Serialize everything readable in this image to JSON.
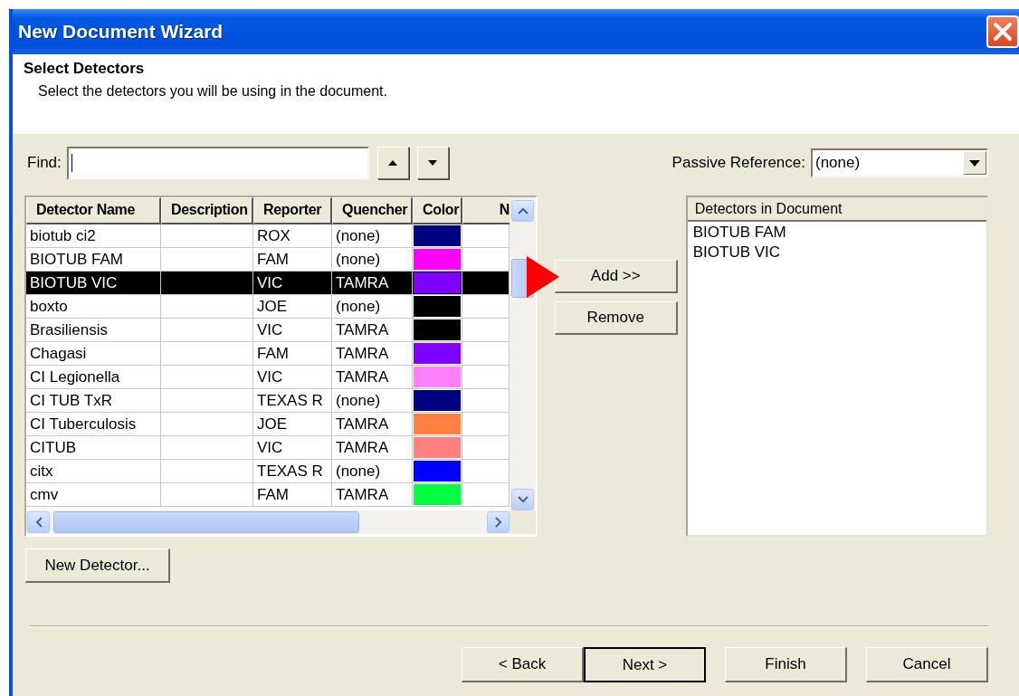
{
  "window": {
    "title": "New Document Wizard"
  },
  "header": {
    "title": "Select Detectors",
    "subtitle": "Select the detectors you will be using in the document."
  },
  "find": {
    "label": "Find:"
  },
  "passive_reference": {
    "label": "Passive Reference:",
    "value": "(none)"
  },
  "table": {
    "columns": [
      "Detector Name",
      "Description",
      "Reporter",
      "Quencher",
      "Color",
      "N"
    ],
    "rows": [
      {
        "detector_name": "biotub ci2",
        "reporter": "ROX",
        "quencher": "(none)",
        "color": "#000080",
        "selected": false
      },
      {
        "detector_name": "BIOTUB FAM",
        "reporter": "FAM",
        "quencher": "(none)",
        "color": "#ff00ff",
        "selected": false
      },
      {
        "detector_name": "BIOTUB VIC",
        "reporter": "VIC",
        "quencher": "TAMRA",
        "color": "#8000ff",
        "selected": true
      },
      {
        "detector_name": "boxto",
        "reporter": "JOE",
        "quencher": "(none)",
        "color": "#000000",
        "selected": false
      },
      {
        "detector_name": "Brasiliensis",
        "reporter": "VIC",
        "quencher": "TAMRA",
        "color": "#000000",
        "selected": false
      },
      {
        "detector_name": "Chagasi",
        "reporter": "FAM",
        "quencher": "TAMRA",
        "color": "#8000ff",
        "selected": false
      },
      {
        "detector_name": "CI Legionella",
        "reporter": "VIC",
        "quencher": "TAMRA",
        "color": "#ff80ff",
        "selected": false
      },
      {
        "detector_name": "CI TUB TxR",
        "reporter": "TEXAS R",
        "quencher": "(none)",
        "color": "#000080",
        "selected": false
      },
      {
        "detector_name": "CI Tuberculosis",
        "reporter": "JOE",
        "quencher": "TAMRA",
        "color": "#ff8040",
        "selected": false
      },
      {
        "detector_name": "CITUB",
        "reporter": "VIC",
        "quencher": "TAMRA",
        "color": "#ff8080",
        "selected": false
      },
      {
        "detector_name": "citx",
        "reporter": "TEXAS R",
        "quencher": "(none)",
        "color": "#0000ff",
        "selected": false
      },
      {
        "detector_name": "cmv",
        "reporter": "FAM",
        "quencher": "TAMRA",
        "color": "#00ff40",
        "selected": false
      }
    ]
  },
  "add_button": "Add >>",
  "remove_button": "Remove",
  "document_detectors": {
    "title": "Detectors in Document",
    "items": [
      "BIOTUB FAM",
      "BIOTUB VIC"
    ]
  },
  "new_detector_button": "New Detector...",
  "nav_buttons": [
    {
      "label": "< Back",
      "default": false
    },
    {
      "label": "Next >",
      "default": true
    },
    {
      "label": "Finish",
      "default": false
    },
    {
      "label": "Cancel",
      "default": false
    }
  ]
}
